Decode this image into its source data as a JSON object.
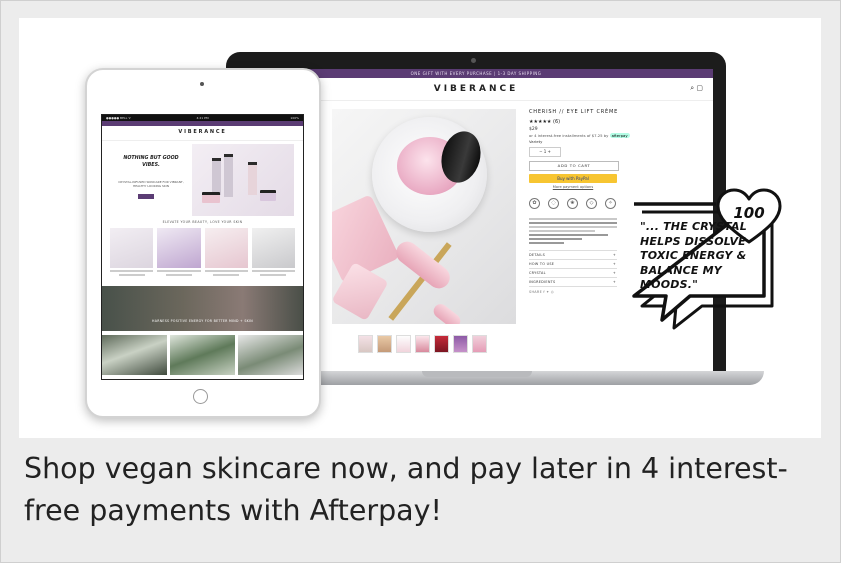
{
  "caption": "Shop vegan skincare now, and pay later in 4 interest-free payments with Afterpay!",
  "laptop_site": {
    "promo_bar": "ONE GIFT WITH EVERY PURCHASE | 1-3 DAY SHIPPING",
    "nav_left": [
      "GOOD VIBE TRIBE",
      "CONTACT"
    ],
    "logo": "VIBERANCE",
    "nav_icons": "⌕ ▢",
    "product": {
      "title": "CHERISH // EYE LIFT CRÈME",
      "stars": "★★★★★ (6)",
      "price": "$29",
      "afterpay_text": "or 4 interest-free installments of $7.25 by",
      "afterpay_badge": "afterpay",
      "variant": "Variety",
      "qty": "−   1   +",
      "add_to_cart": "ADD TO CART",
      "paypal": "Buy with PayPal",
      "more_payment": "More payment options",
      "accordion": [
        "DETAILS",
        "HOW TO USE",
        "CRYSTAL",
        "INGREDIENTS"
      ],
      "share": "SHARE  f  ✦  ◎"
    }
  },
  "tablet_site": {
    "status_left": "●●●●● BELL ᯤ",
    "status_center": "4:21 PM",
    "status_right": "100%",
    "logo": "VIBERANCE",
    "hero_text": "NOTHING BUT GOOD VIBES.",
    "hero_sub": "CRYSTAL-INFUSED SKINCARE FOR VIBRANT, HEALTHY LOOKING SKIN",
    "section_title": "ELEVATE YOUR BEAUTY, LOVE YOUR SKIN",
    "banner_text": "HARNESS POSITIVE ENERGY FOR BETTER MIND + SKIN"
  },
  "quote": {
    "number": "100",
    "text": "\"... THE CRYSTAL HELPS DISSOLVE TOXIC ENERGY & BALANCE MY MOODS.\""
  }
}
